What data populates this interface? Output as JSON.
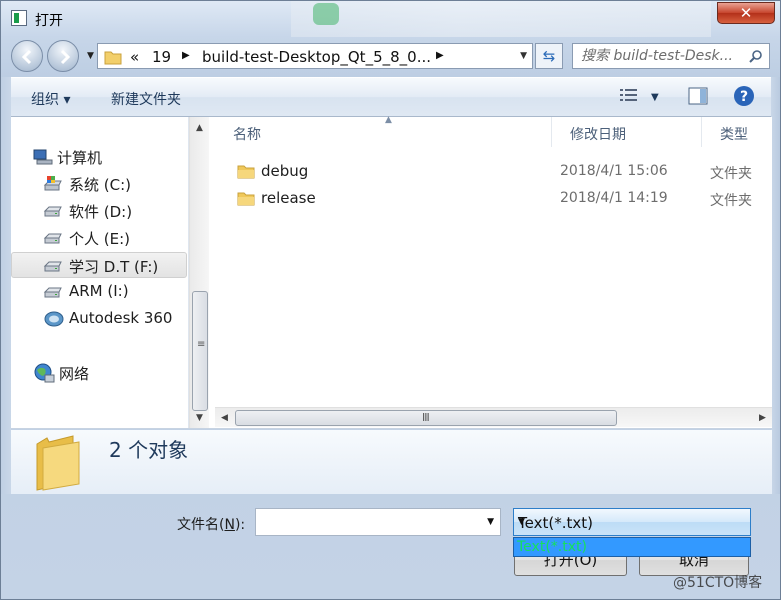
{
  "window": {
    "title": "打开",
    "close_label": "✕"
  },
  "navigation": {
    "back_icon": "back-arrow-icon",
    "forward_icon": "forward-arrow-icon",
    "breadcrumbs": [
      "«",
      "19",
      "build-test-Desktop_Qt_5_8_0..."
    ],
    "refresh_icon": "refresh-arrows-icon"
  },
  "search": {
    "placeholder": "搜索 build-test-Desk..."
  },
  "toolbar": {
    "organize_label": "组织 ▾",
    "new_folder_label": "新建文件夹",
    "view_icon": "view-details-icon",
    "preview_icon": "preview-pane-icon",
    "help_icon": "help-icon"
  },
  "sidebar": {
    "items": [
      {
        "label": "计算机",
        "icon": "computer-icon",
        "selected": false
      },
      {
        "label": "系统 (C:)",
        "icon": "system-drive-icon",
        "selected": false
      },
      {
        "label": "软件 (D:)",
        "icon": "drive-icon",
        "selected": false
      },
      {
        "label": "个人 (E:)",
        "icon": "drive-icon",
        "selected": false
      },
      {
        "label": "学习 D.T (F:)",
        "icon": "drive-icon",
        "selected": true
      },
      {
        "label": "ARM  (I:)",
        "icon": "drive-icon",
        "selected": false
      },
      {
        "label": "Autodesk 360",
        "icon": "cloud-drive-icon",
        "selected": false
      },
      {
        "label": "网络",
        "icon": "network-icon",
        "selected": false
      }
    ]
  },
  "files": {
    "columns": [
      "名称",
      "修改日期",
      "类型"
    ],
    "rows": [
      {
        "name": "debug",
        "date": "2018/4/1 15:06",
        "type": "文件夹"
      },
      {
        "name": "release",
        "date": "2018/4/1 14:19",
        "type": "文件夹"
      }
    ]
  },
  "details": {
    "count_text": "2 个对象"
  },
  "bottom": {
    "filename_label": "文件名(",
    "filename_mnemonic": "N",
    "filename_label_end": "):",
    "filename_value": "",
    "filter_selected": "Text(*.txt)",
    "filter_options": [
      "Text(*.txt)"
    ],
    "open_label": "打开(O)",
    "cancel_label": "取消"
  },
  "watermark": "@51CTO博客",
  "colors": {
    "accent": "#3399ff",
    "dropdown_text": "#16e05f"
  }
}
